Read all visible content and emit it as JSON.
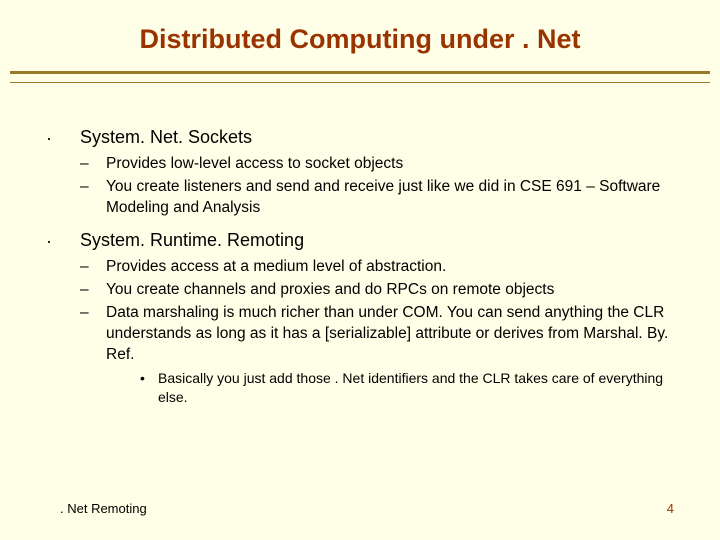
{
  "title": "Distributed Computing under . Net",
  "sections": [
    {
      "heading": "System. Net. Sockets",
      "subs": [
        "Provides low-level access to socket objects",
        "You create listeners and send and receive just like we did in CSE 691 – Software Modeling and Analysis"
      ],
      "subsubs": []
    },
    {
      "heading": "System. Runtime. Remoting",
      "subs": [
        "Provides access at a medium level of abstraction.",
        "You create channels and proxies and do RPCs on remote objects",
        "Data marshaling is much richer than under COM.  You can send anything the CLR understands as long as it has a [serializable] attribute or derives from Marshal. By. Ref."
      ],
      "subsubs": [
        "Basically you just add those . Net identifiers and the CLR takes care of everything else."
      ]
    }
  ],
  "footer_left": ". Net Remoting",
  "footer_right": "4"
}
